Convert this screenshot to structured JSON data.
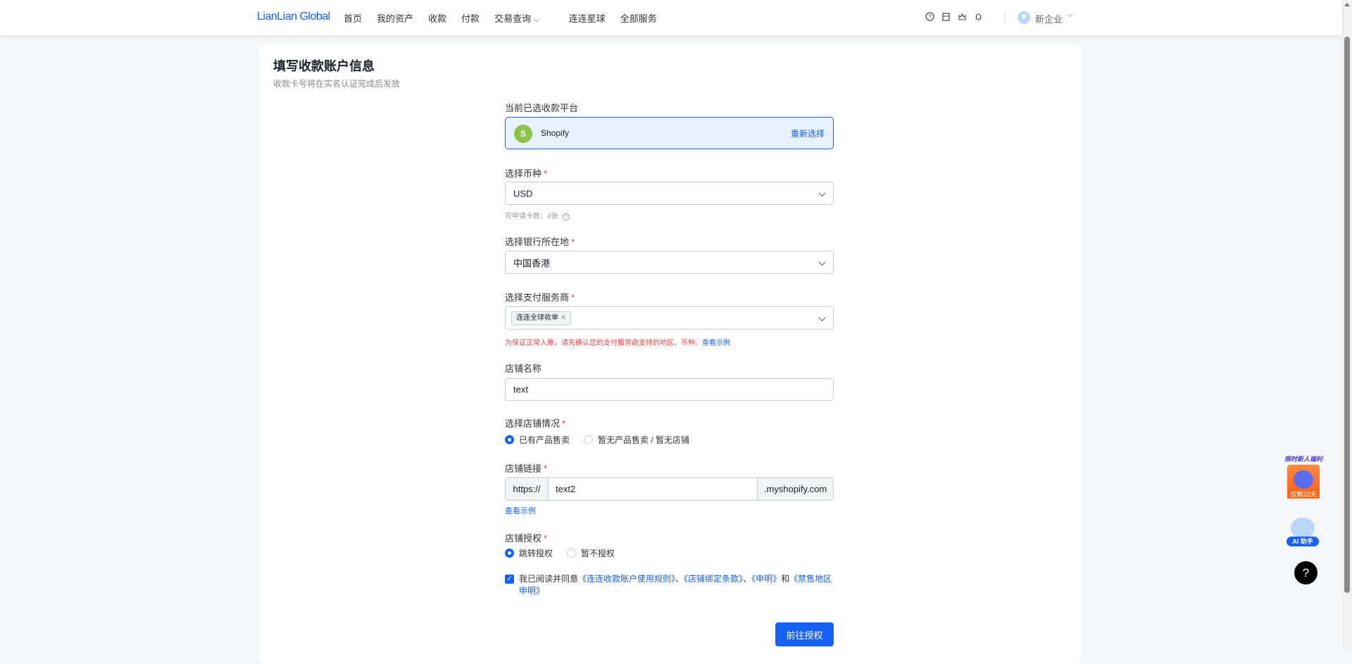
{
  "header": {
    "logo": "LianLian Global",
    "nav": [
      "首页",
      "我的资产",
      "收款",
      "付款",
      "交易查询",
      "连连星球",
      "全部服务"
    ],
    "user": "新企业"
  },
  "page": {
    "title": "填写收款账户信息",
    "subtitle": "收款卡号将在实名认证完成后发放"
  },
  "form": {
    "platform_label": "当前已选收款平台",
    "platform": "Shopify",
    "reselect": "重新选择",
    "currency_label": "选择币种",
    "currency": "USD",
    "card_count": "可申请卡数：4张",
    "bank_label": "选择银行所在地",
    "bank": "中国香港",
    "psp_label": "选择支付服务商",
    "psp_tag": "连连全球收单",
    "psp_warning": "为保证正常入账，请先确认您的支付服务商支持的地区、币种。",
    "psp_example": "查看示例",
    "store_name_label": "店铺名称",
    "store_name": "text",
    "store_status_label": "选择店铺情况",
    "store_status_options": [
      "已有产品售卖",
      "暂无产品售卖 / 暂无店铺"
    ],
    "store_link_label": "店铺链接",
    "link_prefix": "https://",
    "link_value": "text2",
    "link_suffix": ".myshopify.com",
    "link_example": "查看示例",
    "auth_label": "店铺授权",
    "auth_options": [
      "跳转授权",
      "暂不授权"
    ],
    "agree_text": "我已阅读并同意",
    "agree_links": [
      "《连连收款账户使用规则》",
      "《店铺绑定条款》",
      "《申明》",
      "《禁售地区申明》"
    ],
    "sep": "、",
    "and": "和",
    "submit": "前往授权"
  },
  "floating": {
    "promo_title": "限时新人福利",
    "promo_badge": "仅剩22天",
    "ai": "AI 助手",
    "help": "?"
  },
  "colors": {
    "primary": "#1560f5",
    "danger": "#f53f3f"
  }
}
